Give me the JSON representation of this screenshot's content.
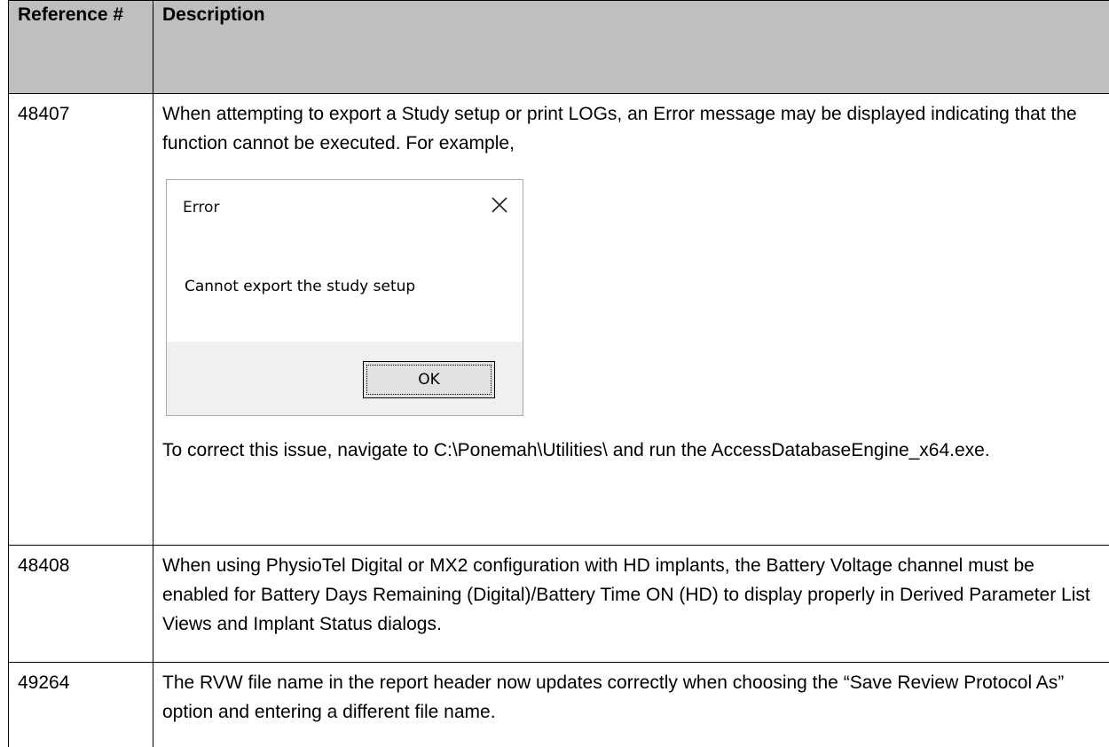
{
  "table": {
    "headers": {
      "reference": "Reference #",
      "description": "Description"
    },
    "rows": [
      {
        "reference": "48407",
        "description_intro": "When attempting to export a Study setup or print LOGs, an Error message may be displayed indicating that the function cannot be executed. For example,",
        "dialog": {
          "title": "Error",
          "message": "Cannot export the study setup",
          "ok_label": "OK",
          "close_icon": "close-icon"
        },
        "description_outro": "To correct this issue, navigate to C:\\Ponemah\\Utilities\\ and run the AccessDatabaseEngine_x64.exe."
      },
      {
        "reference": "48408",
        "description": "When using PhysioTel Digital or MX2 configuration with HD implants, the Battery Voltage channel must be enabled for Battery Days Remaining (Digital)/Battery Time ON (HD) to display properly in Derived Parameter List Views and Implant Status dialogs."
      },
      {
        "reference": "49264",
        "description": "The RVW file name in the report header now updates correctly when choosing the “Save Review Protocol As” option and entering a different file name."
      }
    ]
  },
  "colors": {
    "header_bg": "#bfbfbf",
    "dialog_footer": "#f0f0f0",
    "button_bg": "#e1e1e1"
  }
}
